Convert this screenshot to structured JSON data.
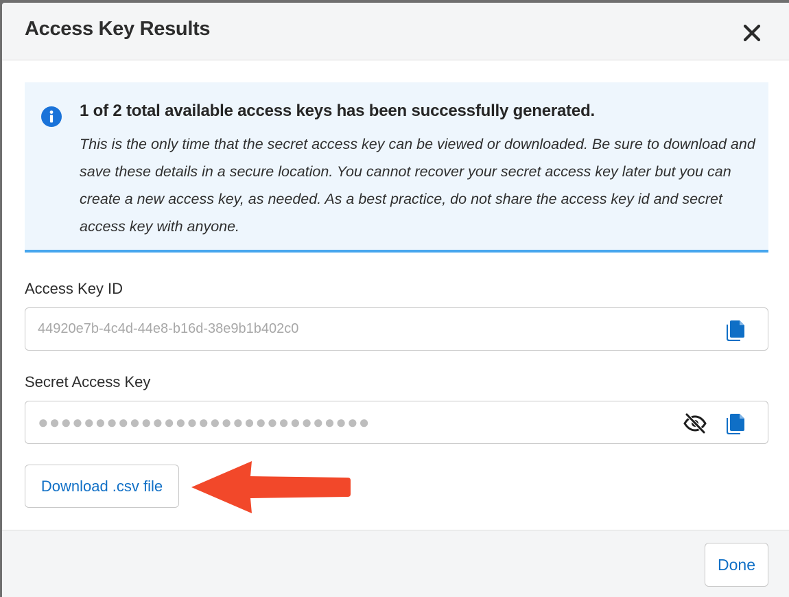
{
  "dialog": {
    "title": "Access Key Results",
    "close_icon": "close-icon"
  },
  "info": {
    "icon": "info-icon",
    "heading": "1 of 2 total available access keys has been successfully generated.",
    "text": "This is the only time that the secret access key can be viewed or downloaded. Be sure to download and save these details in a secure location. You cannot recover your secret access key later but you can create a new access key, as needed. As a best practice, do not share the access key id and secret access key with anyone."
  },
  "fields": {
    "access_key_id": {
      "label": "Access Key ID",
      "value": "44920e7b-4c4d-44e8-b16d-38e9b1b402c0",
      "copy_icon": "copy-icon"
    },
    "secret_access_key": {
      "label": "Secret Access Key",
      "value": "●●●●●●●●●●●●●●●●●●●●●●●●●●●●●",
      "visibility_icon": "eye-slash-icon",
      "copy_icon": "copy-icon"
    }
  },
  "actions": {
    "download_label": "Download .csv file",
    "done_label": "Done"
  },
  "colors": {
    "accent": "#0f6fc6",
    "info_background": "#eef6fd",
    "info_border": "#47a6ee",
    "annotation_arrow": "#f2482a"
  }
}
